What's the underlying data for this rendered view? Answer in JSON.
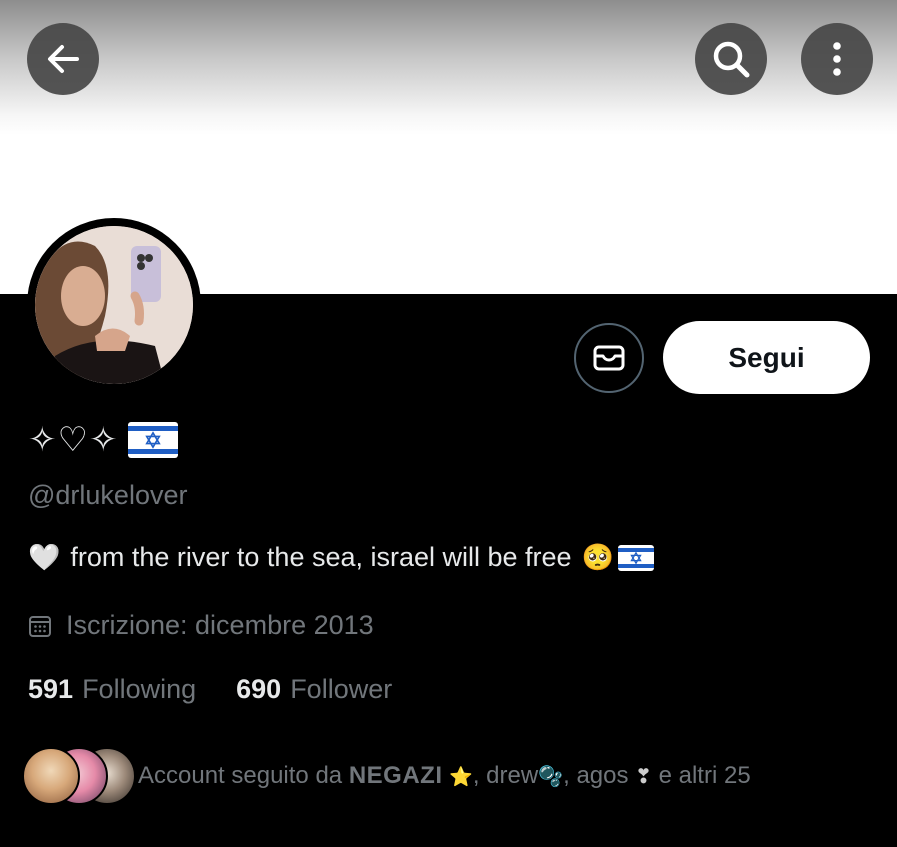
{
  "header": {
    "back_icon": "arrow-left-icon",
    "search_icon": "search-icon",
    "more_icon": "more-vertical-icon"
  },
  "profile": {
    "display_name_symbols": "✧♡✧",
    "display_name_flag": "israel-flag",
    "handle": "@drlukelover",
    "bio_text": "from the river to the sea, israel will be free",
    "bio_emoji_heart": "🤍",
    "bio_emoji_pleading": "🥺",
    "joined_text": "Iscrizione: dicembre 2013",
    "following_count": "591",
    "following_label": "Following",
    "follower_count": "690",
    "follower_label": "Follower"
  },
  "actions": {
    "message_icon": "mail-icon",
    "follow_label": "Segui"
  },
  "followed_by": {
    "prefix": "Account seguito da",
    "name1": "NEGAZI",
    "name1_emoji": "⭐",
    "name2": "drew",
    "name2_emoji": "🫧",
    "name3": "agos",
    "name3_emoji": "❣",
    "suffix": "e altri 25"
  },
  "colors": {
    "background": "#000000",
    "primary_text": "#e7e9ea",
    "secondary_text": "#71767b",
    "follow_button_bg": "#ffffff",
    "follow_button_text": "#0f1419",
    "flag_blue": "#1f5ec4"
  }
}
